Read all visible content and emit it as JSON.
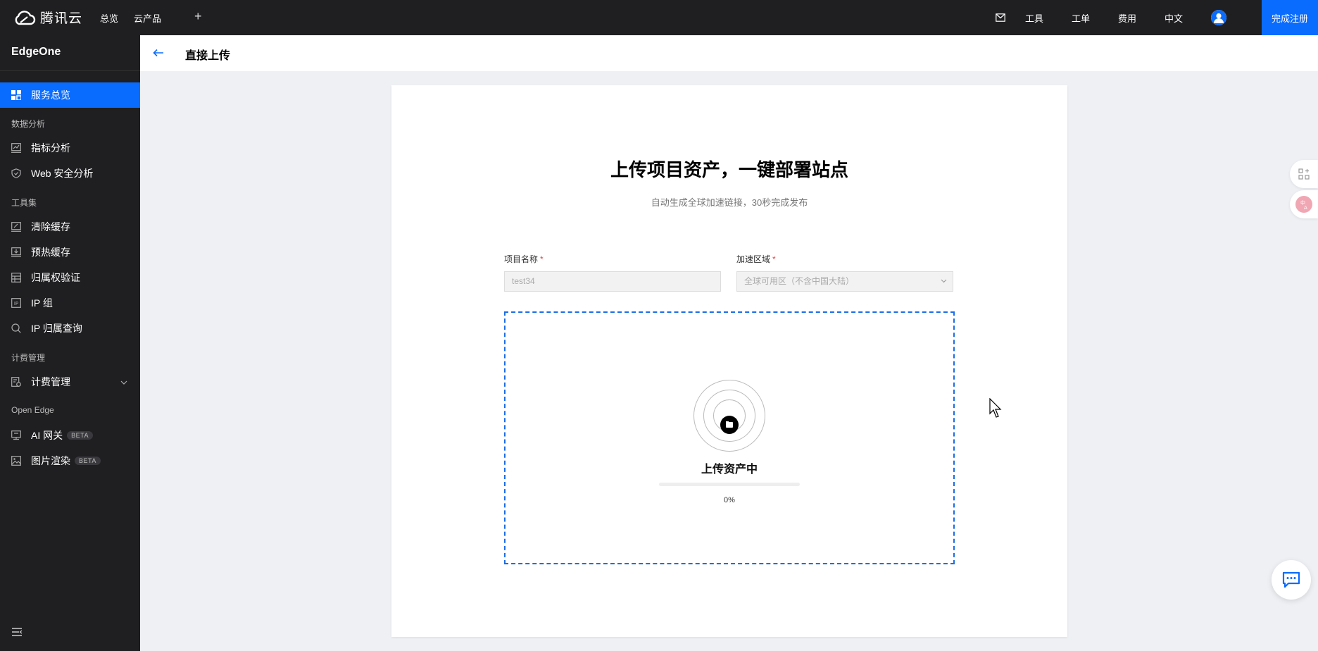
{
  "topbar": {
    "logo_text": "腾讯云",
    "nav": [
      "总览",
      "云产品"
    ],
    "plus_label": "+",
    "right_items": [
      "工具",
      "工单",
      "费用",
      "中文"
    ],
    "register_label": "完成注册"
  },
  "sidebar": {
    "title": "EdgeOne",
    "items": [
      {
        "label": "服务总览",
        "icon": "grid-icon",
        "active": true
      },
      {
        "group": "数据分析"
      },
      {
        "label": "指标分析",
        "icon": "chart-icon"
      },
      {
        "label": "Web 安全分析",
        "icon": "shield-icon"
      },
      {
        "group": "工具集"
      },
      {
        "label": "清除缓存",
        "icon": "clear-cache-icon"
      },
      {
        "label": "预热缓存",
        "icon": "prefetch-icon"
      },
      {
        "label": "归属权验证",
        "icon": "verify-icon"
      },
      {
        "label": "IP 组",
        "icon": "ip-group-icon"
      },
      {
        "label": "IP 归属查询",
        "icon": "search-icon"
      },
      {
        "group": "计费管理"
      },
      {
        "label": "计费管理",
        "icon": "billing-icon",
        "has_submenu": true
      },
      {
        "group": "Open Edge"
      },
      {
        "label": "AI 网关",
        "icon": "ai-gateway-icon",
        "badge": "BETA"
      },
      {
        "label": "图片渲染",
        "icon": "image-icon",
        "badge": "BETA"
      }
    ]
  },
  "page": {
    "title": "直接上传"
  },
  "card": {
    "hero_title": "上传项目资产，一键部署站点",
    "subtitle": "自动生成全球加速链接，30秒完成发布",
    "project_name_label": "项目名称",
    "project_name_value": "test34",
    "region_label": "加速区域",
    "region_value": "全球可用区（不含中国大陆）",
    "required_mark": "*",
    "status_text": "上传资产中",
    "progress_text": "0%",
    "progress_fraction": 0
  },
  "colors": {
    "accent": "#0a6cff",
    "sidebar_bg": "#1f1f22",
    "required": "#e54545"
  }
}
